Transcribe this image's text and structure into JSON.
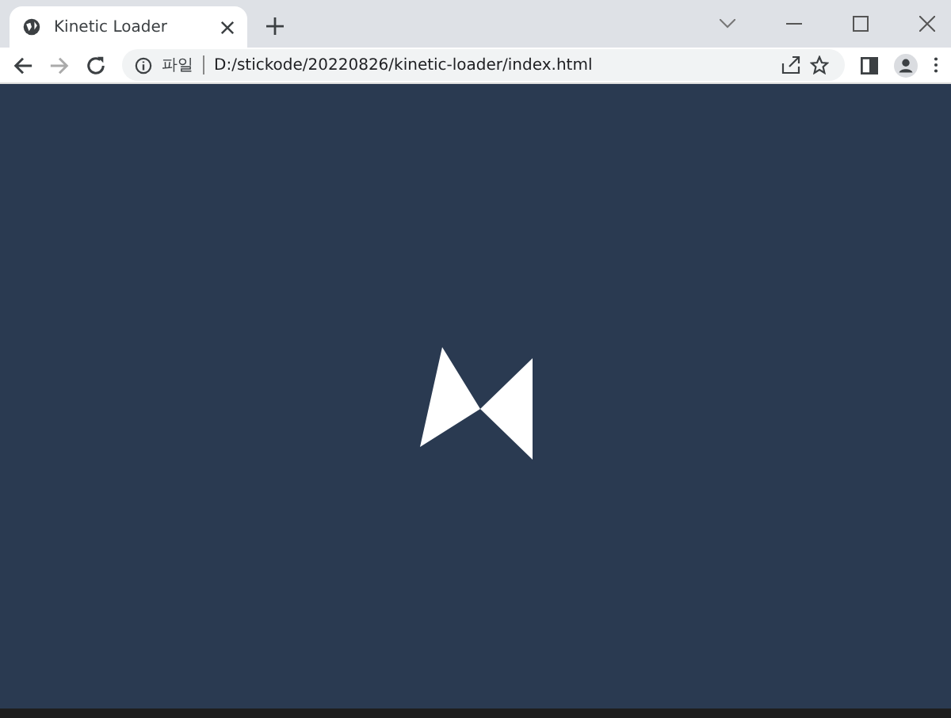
{
  "tab": {
    "title": "Kinetic Loader",
    "selected": true
  },
  "address_bar": {
    "scheme_label": "파일",
    "url": "D:/stickode/20220826/kinetic-loader/index.html"
  }
}
